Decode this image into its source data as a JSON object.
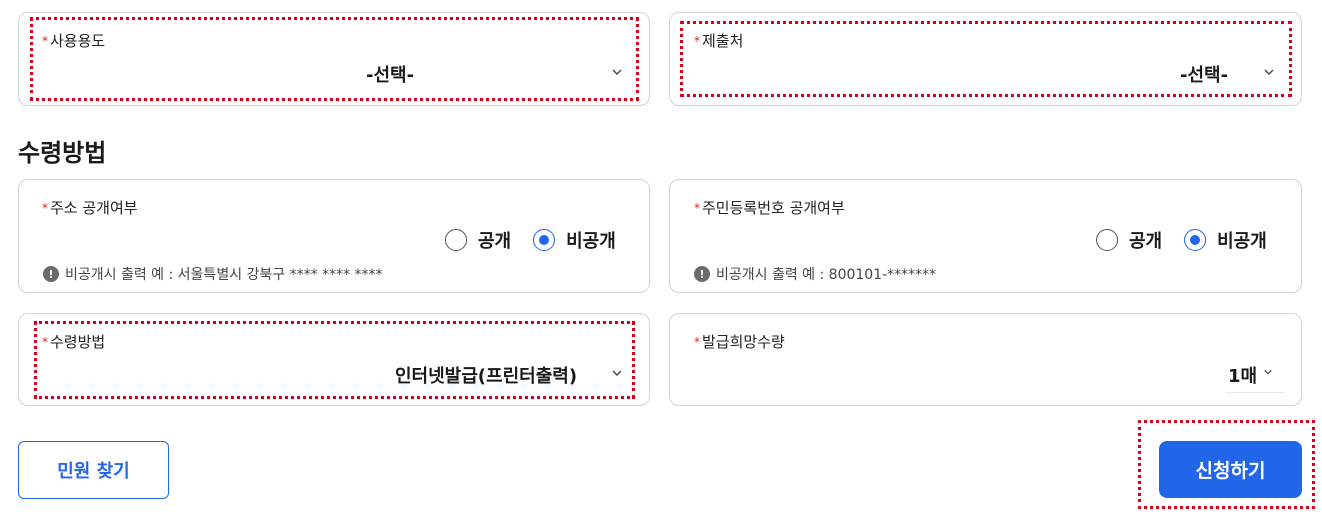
{
  "fields": {
    "usage": {
      "label": "사용용도",
      "value": "-선택-"
    },
    "submit_to": {
      "label": "제출처",
      "value": "-선택-"
    },
    "address_disclosure": {
      "label": "주소 공개여부",
      "options": [
        "공개",
        "비공개"
      ],
      "selected": "비공개",
      "note": "비공개시 출력 예 : 서울특별시 강북구 **** **** ****"
    },
    "rrn_disclosure": {
      "label": "주민등록번호 공개여부",
      "options": [
        "공개",
        "비공개"
      ],
      "selected": "비공개",
      "note": "비공개시 출력 예 : 800101-*******"
    },
    "receive_method": {
      "label": "수령방법",
      "value": "인터넷발급(프린터출력)"
    },
    "quantity": {
      "label": "발급희망수량",
      "value": "1매"
    }
  },
  "section": {
    "title": "수령방법"
  },
  "required_mark": "*",
  "info_icon_glyph": "!",
  "icons": {
    "select_caret": "chevron-down-icon",
    "info": "info-icon"
  },
  "buttons": {
    "find_civil": "민원 찾기",
    "apply": "신청하기"
  },
  "colors": {
    "accent": "#2266ea",
    "required": "#e0242b",
    "highlight_outline": "#d9001b"
  }
}
